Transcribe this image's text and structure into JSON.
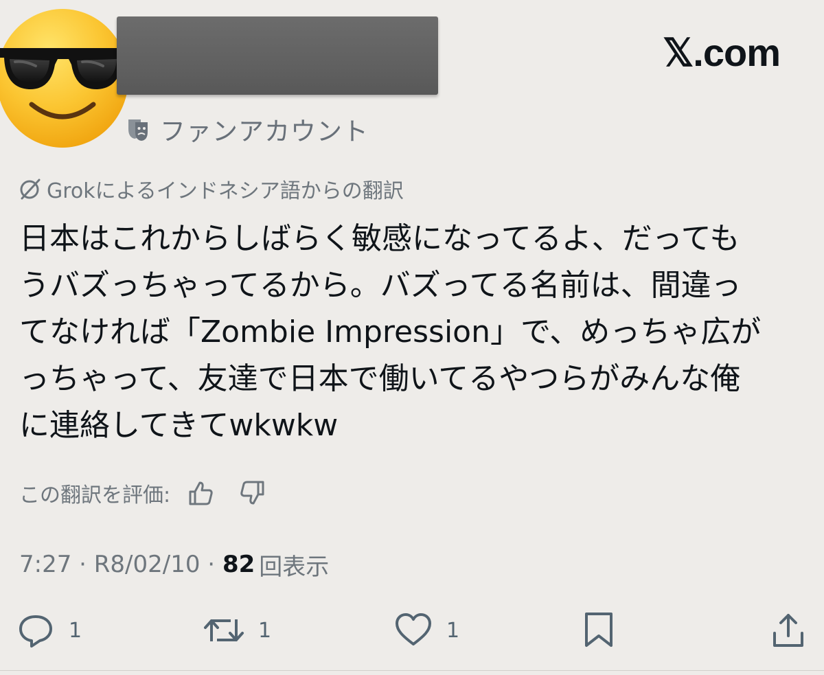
{
  "brand": {
    "text": "𝕏.com"
  },
  "author": {
    "avatar_icon": "sunglasses-emoji-icon",
    "name_hidden": true,
    "label_icon": "theater-mask-icon",
    "label_text": "ファンアカウント"
  },
  "translation": {
    "icon": "grok-slash-icon",
    "notice": "Grokによるインドネシア語からの翻訳"
  },
  "post": {
    "text": "日本はこれからしばらく敏感になってるよ、だっても\nうバズっちゃってるから。バズってる名前は、間違っ\nてなければ「Zombie Impression」で、めっちゃ広が\nっちゃって、友達で日本で働いてるやつらがみんな俺\nに連絡してきてwkwkw"
  },
  "rating": {
    "label": "この翻訳を評価:",
    "thumbs_up_icon": "thumbs-up-icon",
    "thumbs_down_icon": "thumbs-down-icon"
  },
  "meta": {
    "time": "7:27",
    "separator": " · ",
    "date": "R8/02/10",
    "views_count": "82",
    "views_label": "回表示"
  },
  "actions": {
    "reply": {
      "icon": "reply-icon",
      "count": "1"
    },
    "repost": {
      "icon": "repost-icon",
      "count": "1"
    },
    "like": {
      "icon": "heart-icon",
      "count": "1"
    },
    "bookmark": {
      "icon": "bookmark-icon"
    },
    "share": {
      "icon": "share-icon"
    }
  },
  "colors": {
    "background": "#eeece9",
    "text_primary": "#0f1419",
    "text_secondary": "#6e767d",
    "redaction": "#656565"
  }
}
